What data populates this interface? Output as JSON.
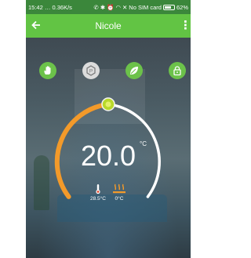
{
  "status_bar": {
    "time": "15:42",
    "network_speed": "0.36K/s",
    "sim_status": "No SIM card",
    "battery": "62%"
  },
  "app_bar": {
    "title": "Nicole",
    "back_icon": "arrow-left-icon",
    "menu_icon": "more-vertical-icon"
  },
  "modes": [
    {
      "name": "manual",
      "icon": "hand-icon",
      "active": false
    },
    {
      "name": "schedule",
      "icon": "program-icon",
      "active": true
    },
    {
      "name": "eco",
      "icon": "leaf-icon",
      "active": false
    },
    {
      "name": "lock",
      "icon": "lock-icon",
      "active": false
    }
  ],
  "thermostat": {
    "set_temperature": "20.0",
    "unit": "°C"
  },
  "readings": {
    "room_temperature": "28.5°C",
    "floor_temperature": "0°C"
  },
  "colors": {
    "status_bar": "#3b873b",
    "app_bar": "#62c444",
    "mode_button": "#6cc24a",
    "arc_active": "#f39a2a",
    "arc_inactive": "#ffffff",
    "knob": "#b8d82a",
    "heating_icon": "#f39a2a"
  }
}
